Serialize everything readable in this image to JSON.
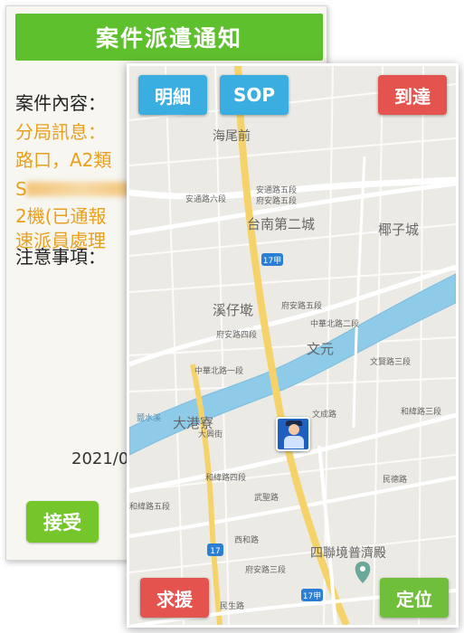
{
  "notice": {
    "title": "案件派遣通知",
    "content_label": "案件內容：",
    "line_branch": "分局訊息：",
    "line_crossing": "路口，A2類",
    "line_s": "S",
    "line_machine": "2機(已通報",
    "line_dispatch": "速派員處理",
    "notes_label": "注意事項：",
    "date": "2021/0",
    "accept_button": "接受"
  },
  "map": {
    "buttons": {
      "detail": "明細",
      "sop": "SOP",
      "arrive": "到達",
      "help": "求援",
      "locate": "定位"
    },
    "labels": {
      "haiweiqian": "海尾前",
      "tainan2": "台南第二城",
      "yeziguo": "椰子城",
      "xizaiji": "溪仔墘",
      "wenyuan": "文元",
      "dagangliao": "大港寮",
      "sijing": "四聯境普濟殿",
      "anton5a": "安通路五段",
      "anan5": "府安路五段",
      "anton6": "安通路六段",
      "wenan5": "府安路五段",
      "anan4": "府安路四段",
      "zhongbei1": "中華北路一段",
      "zhongbei2": "中華北路二段",
      "wencheng": "文成路",
      "hewei5": "和緯路五段",
      "hewei3": "和緯路三段",
      "hewei4": "和緯路四段",
      "wenxian3": "文賢路三段",
      "minde": "民德路",
      "wuxian": "武聖路",
      "ximen": "西和路",
      "anan3": "府安路三段",
      "minsheng": "民生路",
      "dahui": "大興街",
      "yanshui": "鹽水溪",
      "route17a": "17甲",
      "route17": "17"
    }
  },
  "colors": {
    "title_green": "#5fc02e",
    "button_blue": "#3aaee0",
    "button_red": "#e5534f",
    "button_green": "#6fbf3a",
    "river": "#8ecbe8"
  }
}
